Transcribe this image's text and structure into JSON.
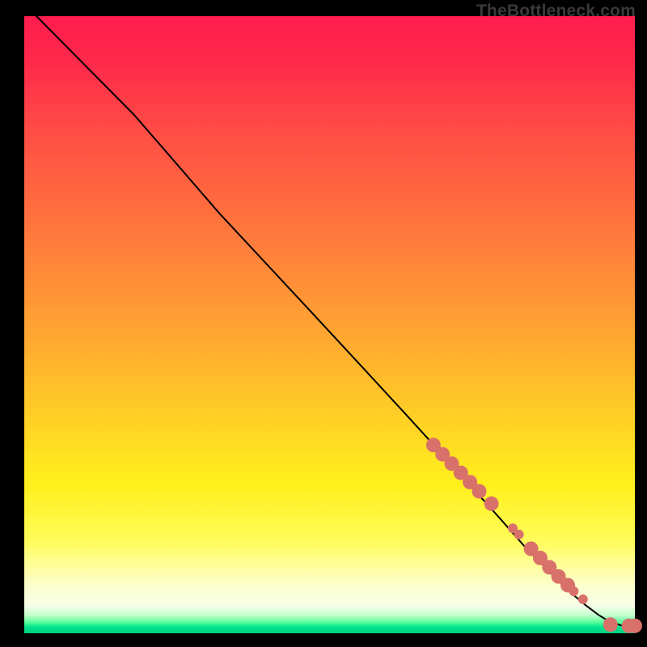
{
  "watermark": "TheBottleneck.com",
  "chart_data": {
    "type": "line",
    "title": "",
    "xlabel": "",
    "ylabel": "",
    "xlim": [
      0,
      100
    ],
    "ylim": [
      0,
      100
    ],
    "grid": false,
    "legend": false,
    "series": [
      {
        "name": "curve",
        "color": "#000000",
        "x": [
          2,
          5,
          8,
          12,
          18,
          25,
          32,
          40,
          48,
          55,
          62,
          68,
          73,
          78,
          82,
          86,
          89,
          92,
          94,
          96,
          98,
          100
        ],
        "y": [
          100,
          97,
          94,
          90,
          84,
          76,
          68,
          59.5,
          51,
          43.5,
          36,
          29.5,
          24,
          18.5,
          14,
          10,
          7,
          4.5,
          3,
          1.8,
          1.2,
          1.2
        ]
      }
    ],
    "markers": {
      "name": "points",
      "color": "#d9716b",
      "radius_major": 9,
      "radius_minor": 6,
      "x": [
        67,
        68.5,
        70,
        71.5,
        73,
        74.5,
        76.5,
        80,
        81,
        83,
        84.5,
        86,
        87.5,
        89,
        90,
        91.5,
        96,
        99,
        100
      ],
      "y": [
        30.5,
        29,
        27.5,
        26,
        24.5,
        23,
        21,
        17,
        16,
        13.7,
        12.2,
        10.7,
        9.2,
        7.8,
        6.8,
        5.5,
        1.4,
        1.2,
        1.2
      ],
      "minor_idx": [
        7,
        8,
        14,
        15
      ]
    }
  }
}
